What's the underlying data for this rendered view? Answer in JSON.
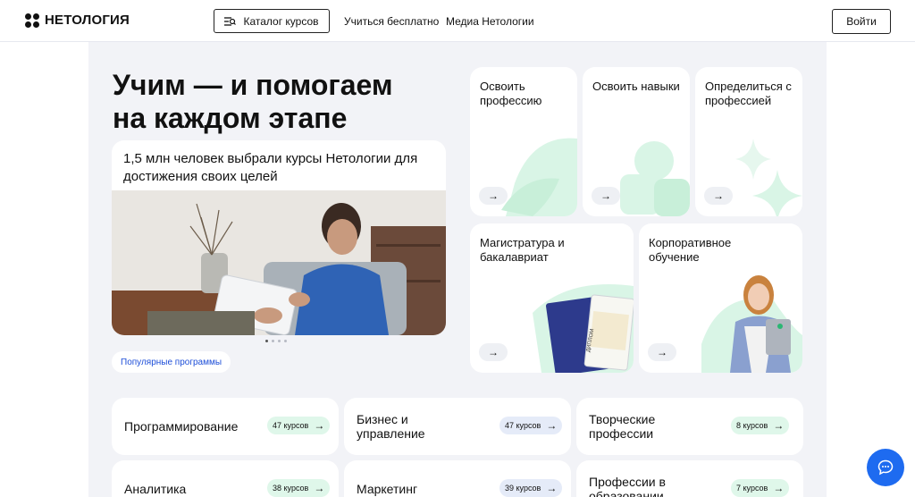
{
  "header": {
    "logo_text": "НЕТОЛОГИЯ",
    "catalog_label": "Каталог курсов",
    "nav_free": "Учиться бесплатно",
    "nav_media": "Медиа Нетологии",
    "login_label": "Войти"
  },
  "hero": {
    "title_line1": "Учим — и помогаем",
    "title_line2": "на каждом этапе",
    "promo_text": "1,5 млн человек выбрали курсы Нетологии для достижения своих целей",
    "popular_chip": "Популярные программы"
  },
  "cards": {
    "profession": "Освоить профессию",
    "skills": "Освоить навыки",
    "define": "Определиться с профессией",
    "masters": "Магистратура и бакалавриат",
    "corporate": "Корпоративное обучение",
    "diploma_word": "ДИПЛОМ"
  },
  "categories": [
    {
      "title": "Программирование",
      "count": "47 курсов"
    },
    {
      "title": "Бизнес и управление",
      "count": "47 курсов"
    },
    {
      "title": "Творческие профессии",
      "count": "8 курсов"
    },
    {
      "title": "Аналитика",
      "count": "38 курсов"
    },
    {
      "title": "Маркетинг",
      "count": "39 курсов"
    },
    {
      "title": "Профессии в образовании",
      "count": "7 курсов"
    }
  ],
  "icons": {
    "arrow": "→",
    "catalog_icon": "catalog-list-icon",
    "chat_icon": "chat-bubble-icon"
  },
  "colors": {
    "accent_blue": "#1e6bf0",
    "mint": "#d9f5e6",
    "panel_bg": "#f2f3f7"
  }
}
